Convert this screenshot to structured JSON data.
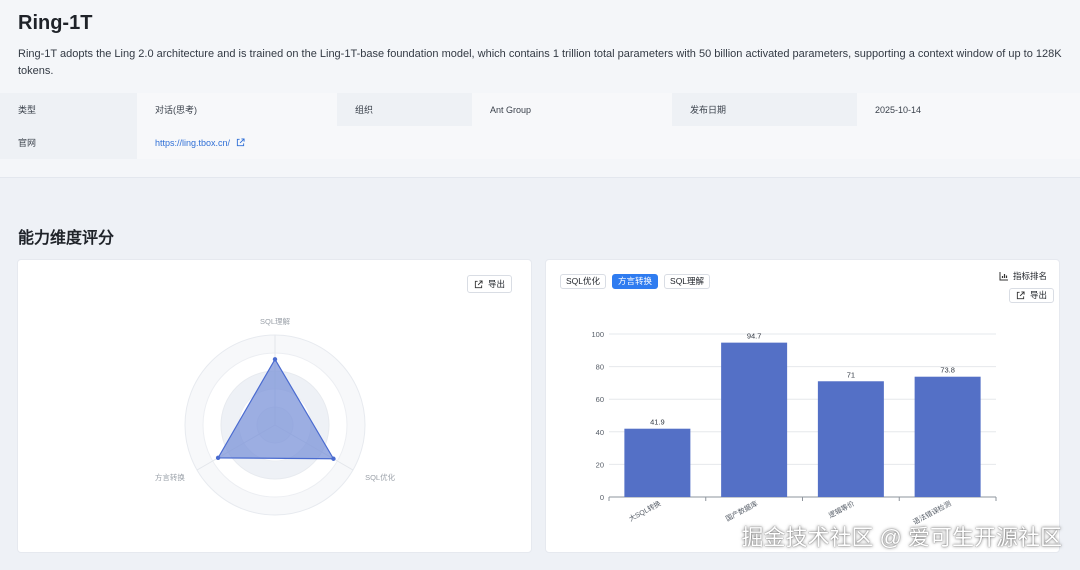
{
  "model": {
    "title": "Ring-1T",
    "description": "Ring-1T adopts the Ling 2.0 architecture and is trained on the Ling-1T-base foundation model, which contains 1 trillion total parameters with 50 billion activated parameters, supporting a context window of up to 128K tokens."
  },
  "info": {
    "type_label": "类型",
    "type_value": "对话(思考)",
    "org_label": "组织",
    "org_value": "Ant Group",
    "date_label": "发布日期",
    "date_value": "2025-10-14",
    "site_label": "官网",
    "site_value": "https://ling.tbox.cn/"
  },
  "section": {
    "title": "能力维度评分"
  },
  "radar_panel": {
    "export_label": "导出"
  },
  "bar_panel": {
    "tabs": [
      {
        "label": "SQL优化",
        "active": false
      },
      {
        "label": "方言转换",
        "active": true
      },
      {
        "label": "SQL理解",
        "active": false
      }
    ],
    "rank_label": "指标排名",
    "export_label": "导出"
  },
  "colors": {
    "accent": "#2f7cf0",
    "bar": "#5470c6",
    "radar_fill": "#7b93d8",
    "link": "#2f6fd6"
  },
  "chart_data": [
    {
      "type": "radar",
      "indicators": [
        "SQL理解",
        "SQL优化",
        "方言转换"
      ],
      "max": 100,
      "series": [
        {
          "values": [
            73,
            75,
            73
          ]
        }
      ]
    },
    {
      "type": "bar",
      "categories": [
        "大SQL转换",
        "国产数据库",
        "逻辑等价",
        "语法错误检测"
      ],
      "values": [
        41.9,
        94.7,
        71,
        73.8
      ],
      "ylim": [
        0,
        100
      ],
      "yticks": [
        0,
        20,
        40,
        60,
        80,
        100
      ],
      "grid": true
    }
  ],
  "watermark": "掘金技术社区 @ 爱可生开源社区"
}
